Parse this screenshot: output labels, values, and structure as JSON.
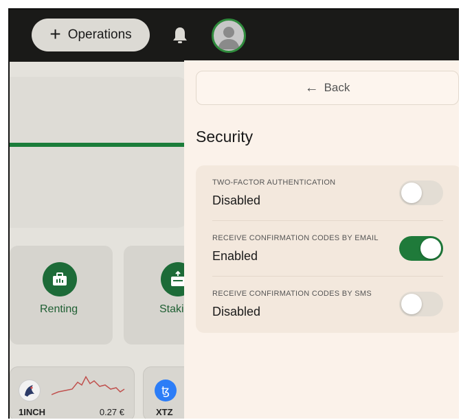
{
  "topbar": {
    "operations_label": "Operations",
    "operations_icon": "plus-icon",
    "notification_icon": "bell-icon",
    "avatar_icon": "user-avatar-icon"
  },
  "dashboard": {
    "tiles": [
      {
        "label": "Renting",
        "icon": "briefcase-icon"
      },
      {
        "label": "Staki",
        "icon": "staking-icon"
      }
    ],
    "coins": [
      {
        "ticker": "1INCH",
        "price": "0.27 €",
        "icon": "1inch-logo"
      },
      {
        "ticker": "XTZ",
        "icon": "tezos-logo"
      }
    ],
    "accent": "#1b7d3a"
  },
  "panel": {
    "back_label": "Back",
    "title": "Security",
    "settings": [
      {
        "label": "TWO-FACTOR AUTHENTICATION",
        "value": "Disabled",
        "enabled": false
      },
      {
        "label": "RECEIVE CONFIRMATION CODES BY EMAIL",
        "value": "Enabled",
        "enabled": true
      },
      {
        "label": "RECEIVE CONFIRMATION CODES BY SMS",
        "value": "Disabled",
        "enabled": false
      }
    ]
  },
  "colors": {
    "toggle_on": "#1f7a3a",
    "toggle_off": "#e3ddd4",
    "panel_bg": "#fbf2ea",
    "topbar_bg": "#1a1a18"
  }
}
